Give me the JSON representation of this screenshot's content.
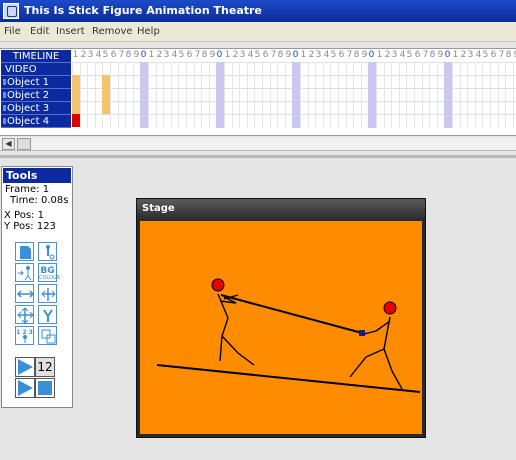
{
  "window": {
    "title": "This Is Stick Figure Animation Theatre"
  },
  "menu": [
    "File",
    "Edit",
    "Insert",
    "Remove",
    "Help"
  ],
  "timeline": {
    "header_label": "TIMELINE",
    "rows": [
      "VIDEO",
      "Object 1",
      "Object 2",
      "Object 3",
      "Object 4"
    ],
    "frame_numbers": [
      "1",
      "2",
      "3",
      "4",
      "5",
      "6",
      "7",
      "8",
      "9",
      "0",
      "1",
      "2",
      "3",
      "4",
      "5",
      "6",
      "7",
      "8",
      "9",
      "0",
      "1",
      "2",
      "3",
      "4",
      "5",
      "6",
      "7",
      "8",
      "9",
      "0",
      "1",
      "2",
      "3",
      "4",
      "5",
      "6",
      "7",
      "8",
      "9",
      "0",
      "1",
      "2",
      "3",
      "4",
      "5",
      "6",
      "7",
      "8",
      "9",
      "0",
      "1",
      "2",
      "3",
      "4",
      "5",
      "6",
      "7",
      "8",
      "9"
    ]
  },
  "tools": {
    "title": "Tools",
    "frame_label": "Frame: 1",
    "time_label": "Time: 0.08s",
    "xpos_label": "X Pos: 1",
    "ypos_label": "Y Pos: 123",
    "bg_label": "BG",
    "colour_label": "COLOUR",
    "seq_label": "1 2 3",
    "speed_value": "12"
  },
  "stage": {
    "title": "Stage"
  },
  "colors": {
    "title_bar": "#0a2c9a",
    "timeline_label": "#0b2aa0",
    "stage_background": "#ff8c00",
    "figure_head": "#e60000",
    "keyframe_orange": "#f5c46c",
    "keyframe_red": "#e00000"
  }
}
